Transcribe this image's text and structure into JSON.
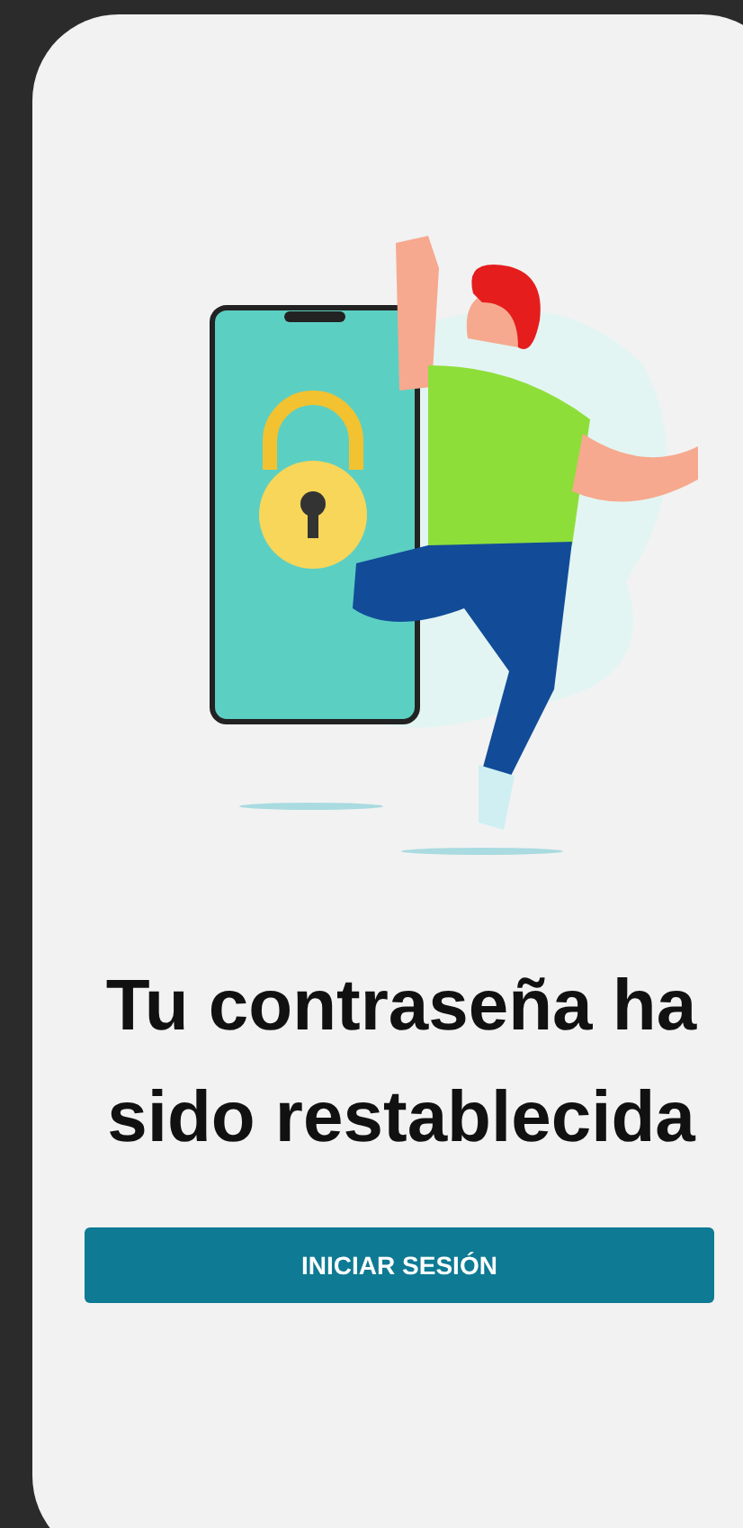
{
  "title": "Tu contraseña ha sido restablecida",
  "button": {
    "label": "INICIAR SESIÓN"
  }
}
